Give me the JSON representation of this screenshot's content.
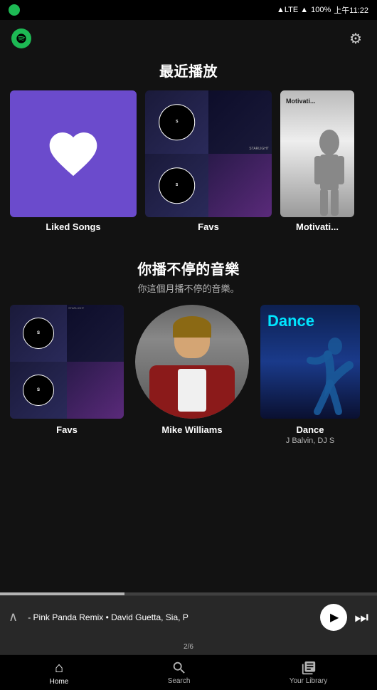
{
  "statusBar": {
    "carrier": "",
    "networkType": "LTE",
    "battery": "100%",
    "time": "上午11:22"
  },
  "header": {
    "settingsLabel": "⚙"
  },
  "recentSection": {
    "title": "最近播放",
    "items": [
      {
        "id": "liked-songs",
        "label": "Liked Songs"
      },
      {
        "id": "favs",
        "label": "Favs"
      },
      {
        "id": "motivation",
        "label": "Motivati..."
      }
    ]
  },
  "recommendSection": {
    "title": "你播不停的音樂",
    "subtitle": "你這個月播不停的音樂。",
    "items": [
      {
        "id": "favs2",
        "label": "Favs",
        "sublabel": ""
      },
      {
        "id": "mike-williams",
        "label": "Mike Williams",
        "sublabel": ""
      },
      {
        "id": "dance",
        "label": "Dance",
        "sublabel": "J Balvin, DJ S"
      }
    ]
  },
  "nowPlaying": {
    "track": "- Pink Panda Remix • David Guetta, Sia, P",
    "chevron": "∧",
    "pageIndicator": "2/6"
  },
  "bottomNav": {
    "items": [
      {
        "id": "home",
        "label": "Home",
        "icon": "⌂",
        "active": true
      },
      {
        "id": "search",
        "label": "Search",
        "icon": "🔍",
        "active": false
      },
      {
        "id": "library",
        "label": "Your Library",
        "icon": "≡",
        "active": false
      }
    ]
  }
}
